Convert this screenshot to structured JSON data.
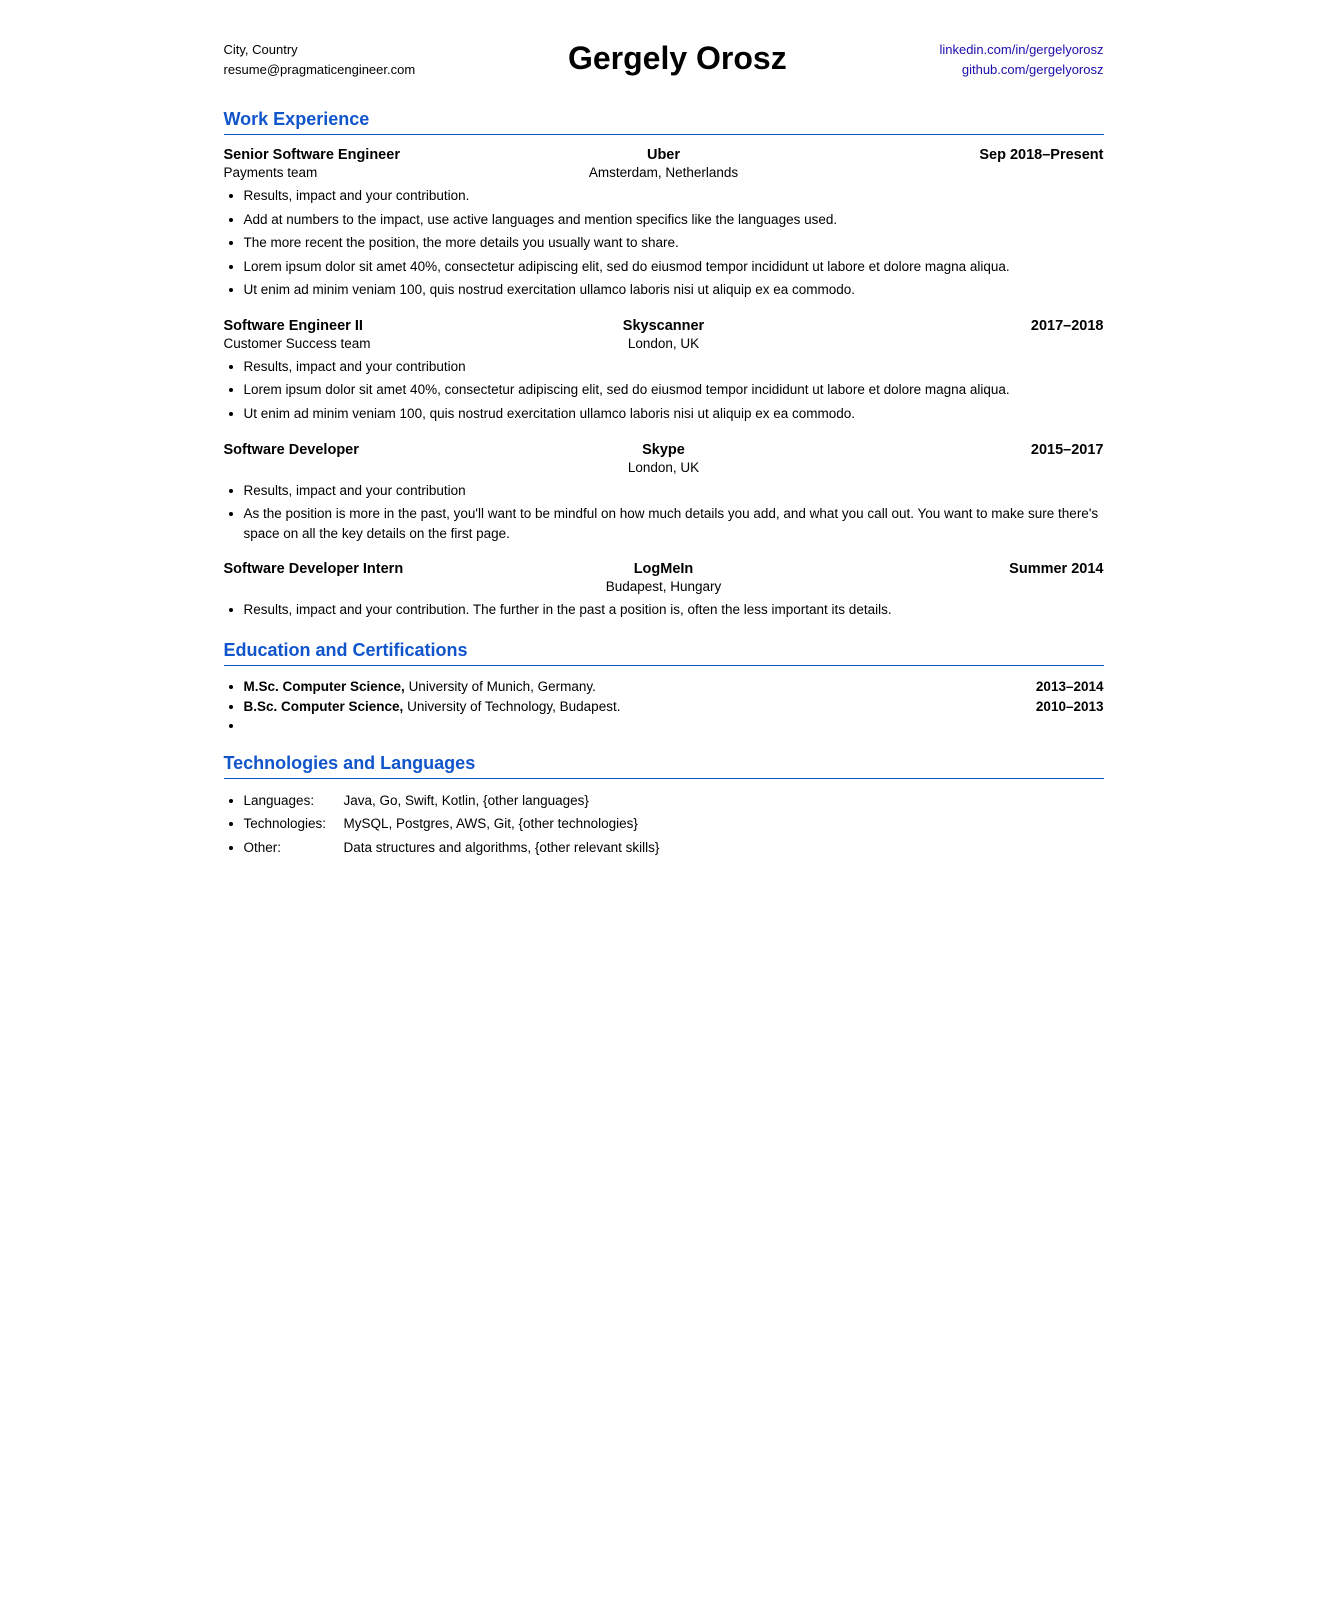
{
  "header": {
    "city": "City, Country",
    "email": "resume@pragmaticengineer.com",
    "name": "Gergely Orosz",
    "linkedin": "linkedin.com/in/gergelyorosz",
    "github": "github.com/gergelyorosz"
  },
  "sections": {
    "work_experience": {
      "title": "Work Experience",
      "jobs": [
        {
          "title": "Senior Software Engineer",
          "company": "Uber",
          "dates": "Sep 2018–Present",
          "team": "Payments team",
          "location": "Amsterdam, Netherlands",
          "bullets": [
            "Results, impact and your contribution.",
            "Add at numbers to the impact, use active languages and mention specifics like the languages used.",
            "The more recent the position, the more details you usually want to share.",
            "Lorem ipsum dolor sit amet 40%, consectetur adipiscing elit, sed do eiusmod tempor incididunt ut labore et dolore magna aliqua.",
            "Ut enim ad minim veniam 100, quis nostrud exercitation ullamco laboris nisi ut aliquip ex ea commodo."
          ]
        },
        {
          "title": "Software Engineer II",
          "company": "Skyscanner",
          "dates": "2017–2018",
          "team": "Customer Success team",
          "location": "London, UK",
          "bullets": [
            "Results, impact and your contribution",
            "Lorem ipsum dolor sit amet 40%, consectetur adipiscing elit, sed do eiusmod tempor incididunt ut labore et dolore magna aliqua.",
            "Ut enim ad minim veniam 100, quis nostrud exercitation ullamco laboris nisi ut aliquip ex ea commodo."
          ]
        },
        {
          "title": "Software Developer",
          "company": "Skype",
          "dates": "2015–2017",
          "team": "",
          "location": "London, UK",
          "bullets": [
            "Results, impact and your contribution",
            "As the position is more in the past, you'll want to be mindful on how much details you add, and what you call out. You want to make sure there's space on all the key details on the first page."
          ]
        },
        {
          "title": "Software Developer Intern",
          "company": "LogMeIn",
          "dates": "Summer 2014",
          "team": "",
          "location": "Budapest, Hungary",
          "bullets": [
            "Results, impact and your contribution. The further in the past a position is, often the less important its details."
          ]
        }
      ]
    },
    "education": {
      "title": "Education and Certifications",
      "items": [
        {
          "degree": "M.Sc. Computer Science,",
          "institution": "University of Munich, Germany.",
          "dates": "2013–2014"
        },
        {
          "degree": "B.Sc. Computer Science,",
          "institution": "University of Technology, Budapest.",
          "dates": "2010–2013"
        }
      ]
    },
    "technologies": {
      "title": "Technologies and Languages",
      "items": [
        {
          "label": "Languages:",
          "value": "Java, Go, Swift, Kotlin, {other languages}"
        },
        {
          "label": "Technologies:",
          "value": "MySQL, Postgres, AWS, Git, {other technologies}"
        },
        {
          "label": "Other:",
          "value": "Data structures and algorithms, {other relevant skills}"
        }
      ]
    }
  }
}
